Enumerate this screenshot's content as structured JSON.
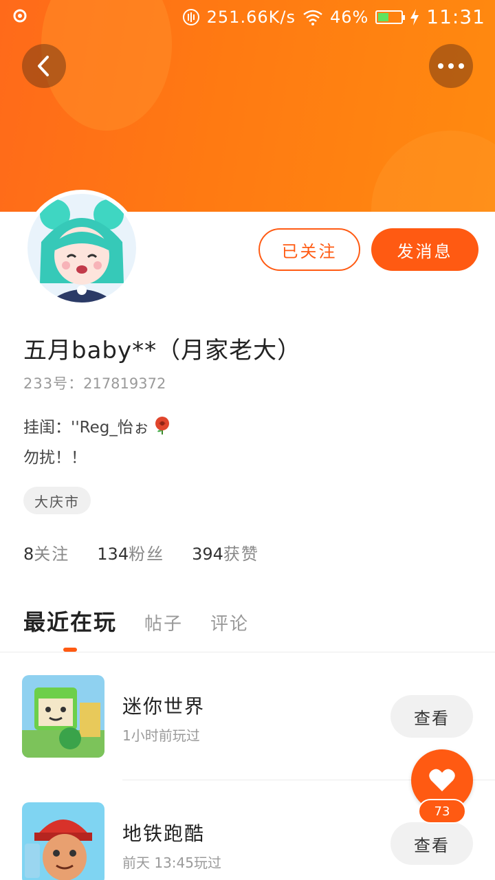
{
  "status_bar": {
    "network_speed": "251.66K/s",
    "battery_percent": "46%",
    "battery_level": 0.46,
    "time": "11:31",
    "icons": [
      "notification-icon",
      "nfc-icon",
      "wifi-icon",
      "battery-icon",
      "charging-icon"
    ]
  },
  "header": {
    "back_icon": "chevron-left-icon",
    "more_icon": "more-dots-icon"
  },
  "profile": {
    "name": "五月baby**（月家老大）",
    "uid_label": "233号：",
    "uid_value": "217819372",
    "bio_line1": "挂闺：''Reg_怡ぉ",
    "bio_line2": "勿扰！！",
    "location": "大庆市"
  },
  "actions": {
    "follow_label": "已关注",
    "message_label": "发消息"
  },
  "stats": [
    {
      "num": "8",
      "label": "关注"
    },
    {
      "num": "134",
      "label": "粉丝"
    },
    {
      "num": "394",
      "label": "获赞"
    }
  ],
  "tabs": [
    {
      "label": "最近在玩",
      "active": true
    },
    {
      "label": "帖子",
      "active": false
    },
    {
      "label": "评论",
      "active": false
    }
  ],
  "games": [
    {
      "title": "迷你世界",
      "subtitle": "1小时前玩过",
      "button": "查看"
    },
    {
      "title": "地铁跑酷",
      "subtitle": "前天  13:45玩过",
      "button": "查看"
    }
  ],
  "like": {
    "count": "73",
    "icon": "heart-icon"
  },
  "colors": {
    "accent": "#ff5a12",
    "banner": "#ff7a12"
  }
}
